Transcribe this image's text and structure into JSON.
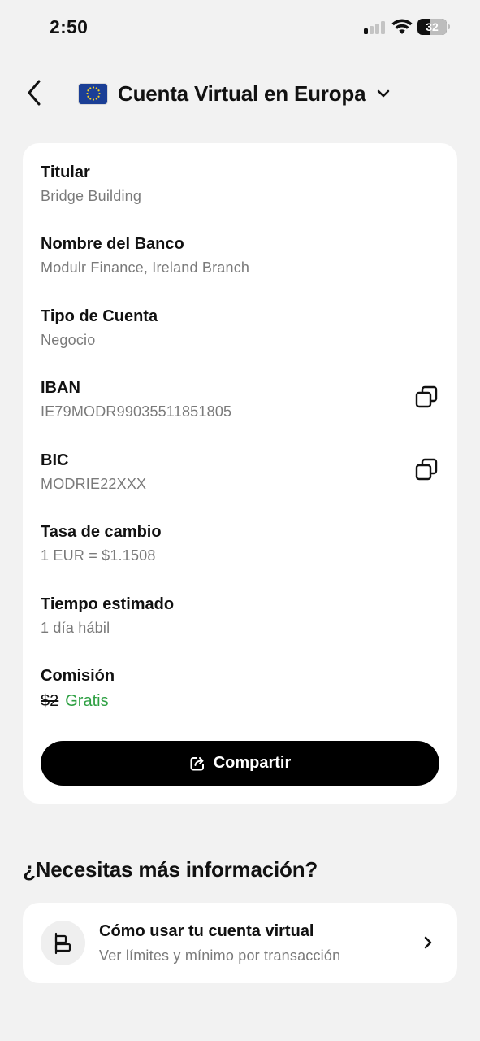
{
  "status_bar": {
    "time": "2:50",
    "battery_level": "32",
    "signal_bars_on": 1,
    "signal_bars_total": 4
  },
  "header": {
    "title": "Cuenta Virtual en Europa",
    "flag_icon": "eu-flag-icon",
    "back_icon": "chevron-left-icon",
    "dropdown_icon": "chevron-down-icon"
  },
  "account": {
    "fields": [
      {
        "label": "Titular",
        "value": "Bridge Building"
      },
      {
        "label": "Nombre del Banco",
        "value": "Modulr Finance, Ireland Branch"
      },
      {
        "label": "Tipo de Cuenta",
        "value": "Negocio"
      },
      {
        "label": "IBAN",
        "value": "IE79MODR99035511851805",
        "copyable": true
      },
      {
        "label": "BIC",
        "value": "MODRIE22XXX",
        "copyable": true
      },
      {
        "label": "Tasa de cambio",
        "value": "1 EUR = $1.1508"
      },
      {
        "label": "Tiempo estimado",
        "value": "1 día hábil"
      }
    ],
    "fee": {
      "label": "Comisión",
      "old_price": "$2",
      "new_price": "Gratis",
      "new_price_color": "#2ea043"
    },
    "share_button": {
      "label": "Compartir",
      "icon": "share-icon"
    }
  },
  "info": {
    "section_title": "¿Necesitas más información?",
    "card": {
      "title": "Cómo usar tu cuenta virtual",
      "subtitle": "Ver límites y mínimo por transacción",
      "icon": "document-layout-icon"
    }
  }
}
